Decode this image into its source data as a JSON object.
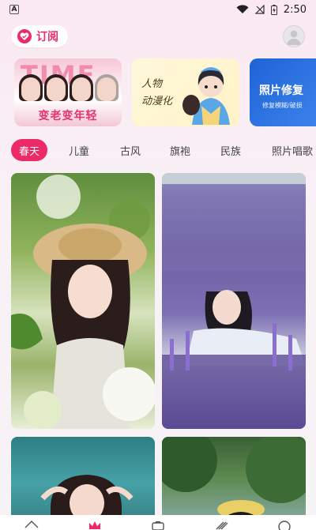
{
  "status_bar": {
    "time": "2:50",
    "a_badge": "A",
    "icons": [
      "wifi-icon",
      "no-signal-icon",
      "battery-charging-icon"
    ]
  },
  "header": {
    "subscribe_label": "订阅",
    "subscribe_icon": "heart-check-icon",
    "avatar_icon": "user-avatar-icon",
    "accent_color": "#ec2a67"
  },
  "banners": [
    {
      "title": "TIME",
      "caption": "变老变年轻"
    },
    {
      "text_line1": "人物",
      "text_line2": "动漫化"
    },
    {
      "title": "照片修复",
      "subtitle": "修复模糊/破损"
    }
  ],
  "tabs": [
    {
      "label": "春天",
      "active": true
    },
    {
      "label": "儿童",
      "active": false
    },
    {
      "label": "古风",
      "active": false
    },
    {
      "label": "旗袍",
      "active": false
    },
    {
      "label": "民族",
      "active": false
    },
    {
      "label": "照片唱歌",
      "active": false
    }
  ],
  "cards": [
    {
      "name": "photo-card-flowers-hat"
    },
    {
      "name": "photo-card-lavender"
    },
    {
      "name": "photo-card-water"
    },
    {
      "name": "photo-card-trees"
    }
  ],
  "bottom_nav": [
    "home-icon",
    "crown-icon",
    "camera-icon",
    "brush-icon",
    "smile-icon"
  ]
}
